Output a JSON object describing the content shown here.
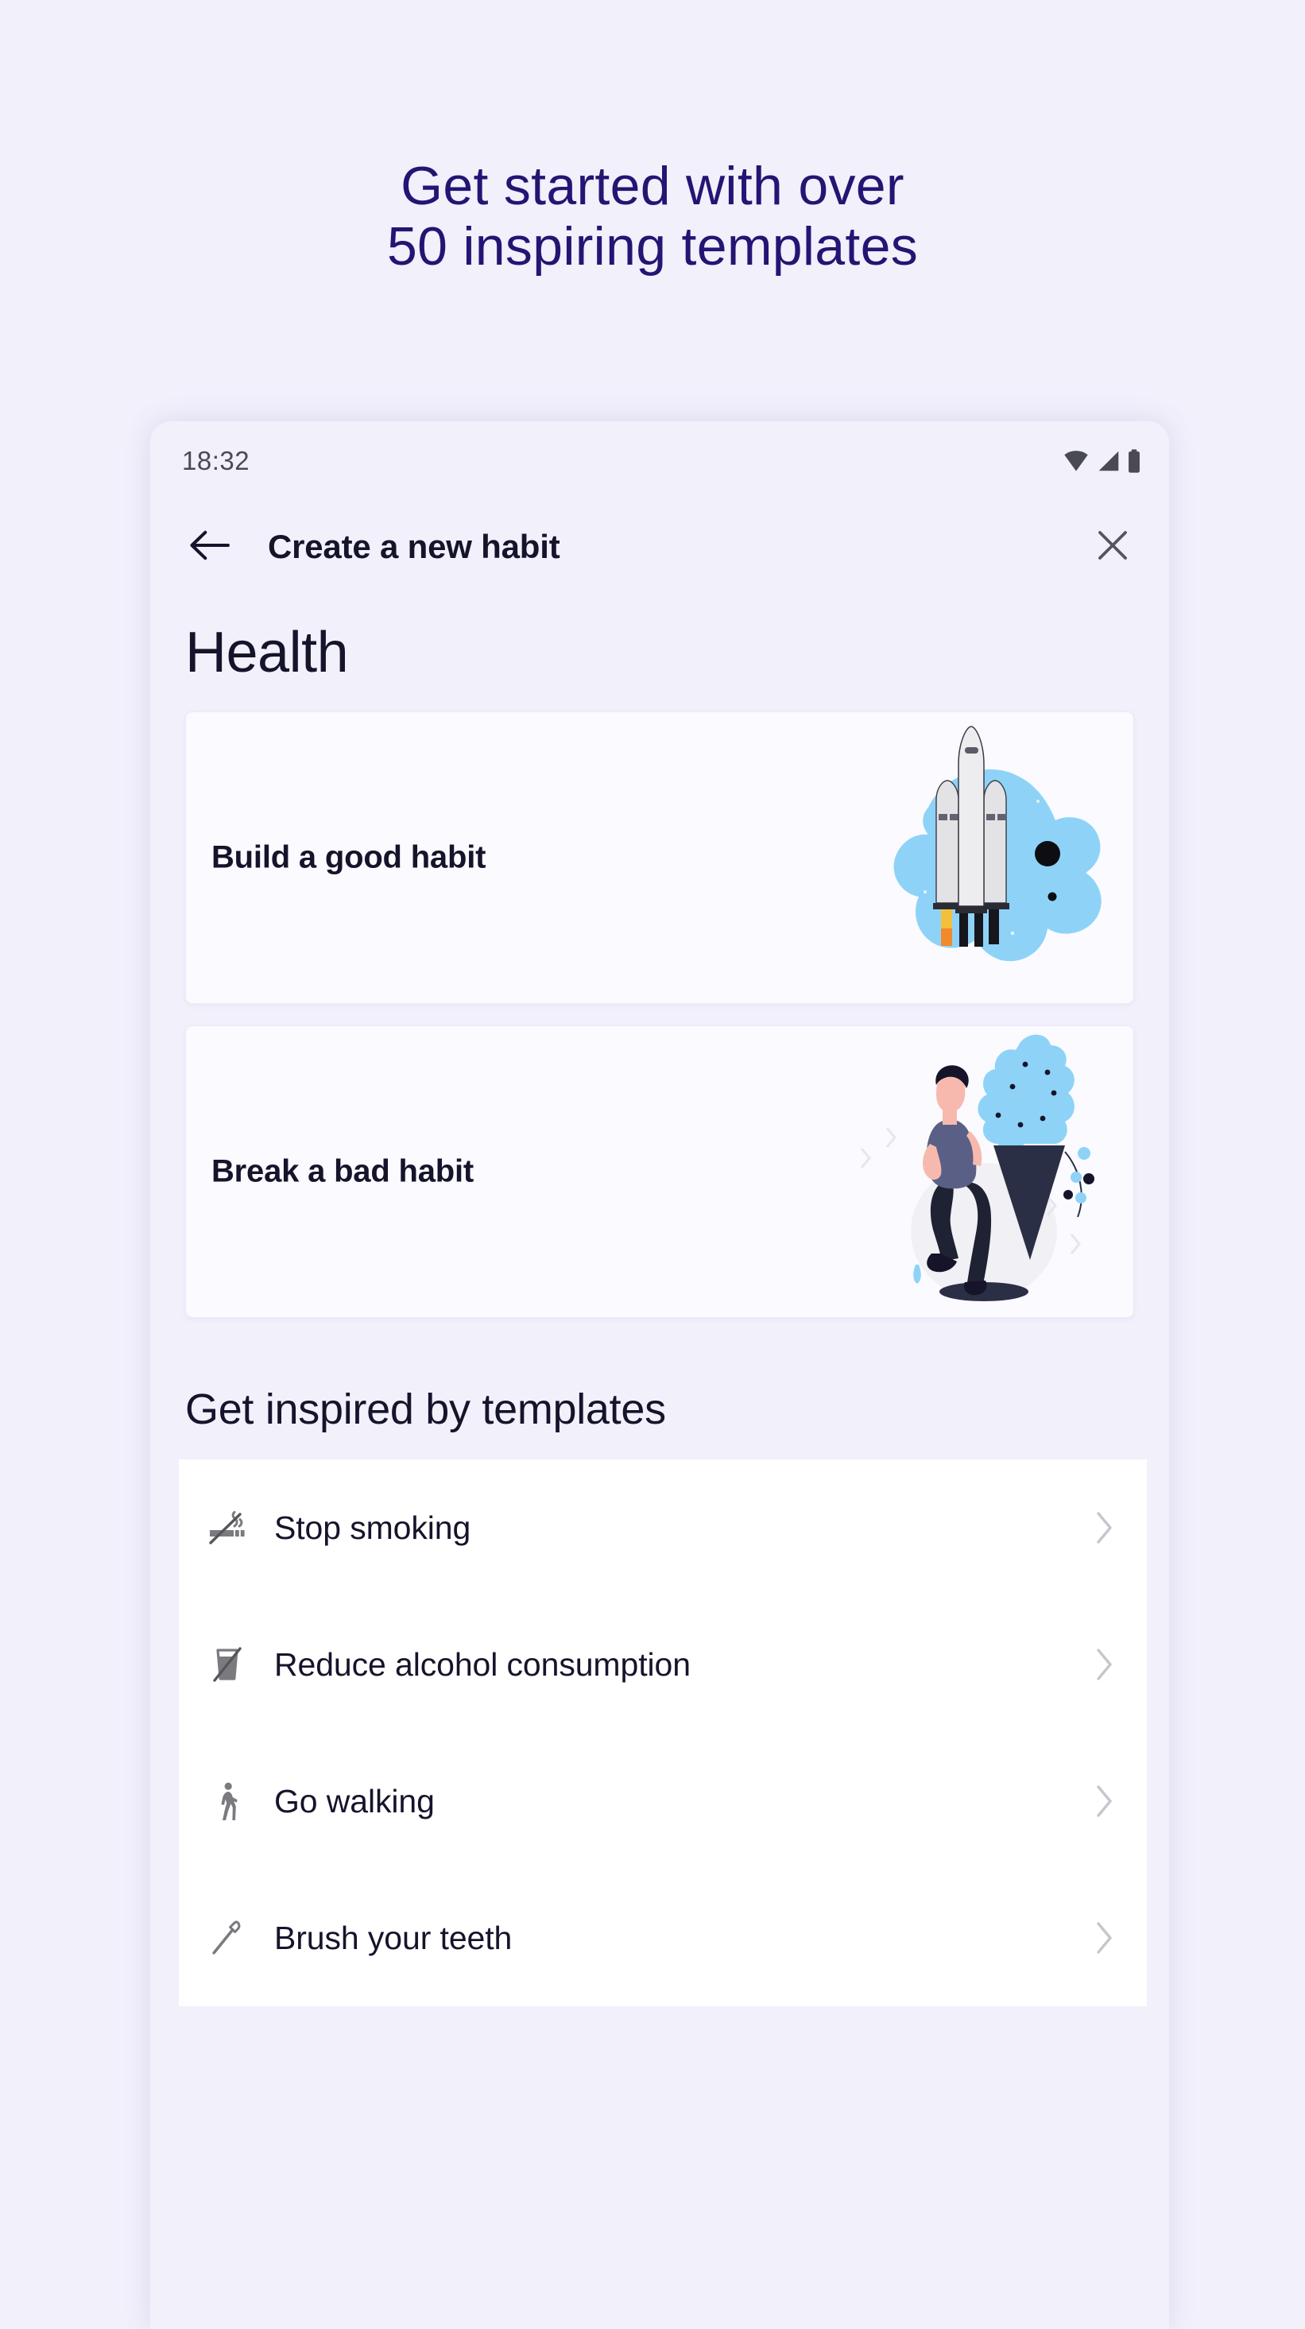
{
  "promo": {
    "headline_line1": "Get started with over",
    "headline_line2": "50 inspiring templates",
    "headline_color": "#231573"
  },
  "phone": {
    "statusbar": {
      "time": "18:32",
      "icons": [
        "wifi-icon",
        "cellular-signal-icon",
        "battery-icon"
      ]
    },
    "appbar": {
      "back_icon": "arrow-left-icon",
      "title": "Create a new habit",
      "close_icon": "close-icon"
    },
    "category_title": "Health",
    "habit_cards": [
      {
        "label": "Build a good habit",
        "art": "rocket-launch-illustration"
      },
      {
        "label": "Break a bad habit",
        "art": "person-with-ice-cream-illustration"
      }
    ],
    "templates": {
      "heading": "Get inspired by templates",
      "items": [
        {
          "label": "Stop smoking",
          "icon": "no-smoking-icon",
          "chevron": "chevron-right-icon"
        },
        {
          "label": "Reduce alcohol consumption",
          "icon": "no-drink-icon",
          "chevron": "chevron-right-icon"
        },
        {
          "label": "Go walking",
          "icon": "walking-person-icon",
          "chevron": "chevron-right-icon"
        },
        {
          "label": "Brush your teeth",
          "icon": "toothbrush-icon",
          "chevron": "chevron-right-icon"
        }
      ]
    }
  },
  "colors": {
    "page_background": "#f1f0fb",
    "phone_background": "#f1f0fb",
    "card_background": "#fafaff",
    "list_background": "#ffffff",
    "text_primary": "#15142b",
    "icon_gray": "#7a7a7f",
    "illustration_blue": "#8ed3f7",
    "illustration_dark": "#2b2f45"
  }
}
